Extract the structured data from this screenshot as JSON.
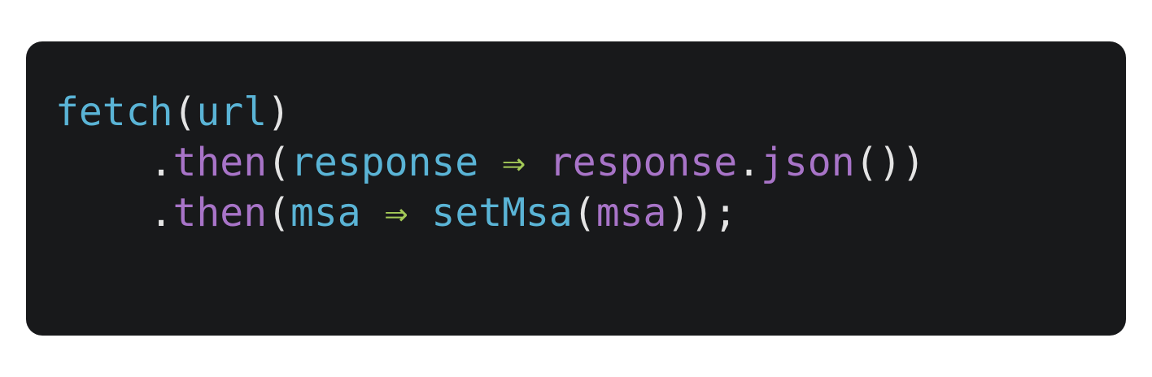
{
  "colors": {
    "background": "#ffffff",
    "panel": "#18191b",
    "function": "#5ab4d6",
    "method": "#a874c8",
    "arrow": "#a3c957",
    "punctuation": "#e4e4e4"
  },
  "code": {
    "lines": [
      {
        "indent": "",
        "tokens": [
          {
            "text": "fetch",
            "kind": "fn"
          },
          {
            "text": "(",
            "kind": "punct"
          },
          {
            "text": "url",
            "kind": "param"
          },
          {
            "text": ")",
            "kind": "punct"
          }
        ]
      },
      {
        "indent": "    ",
        "tokens": [
          {
            "text": ".",
            "kind": "punct"
          },
          {
            "text": "then",
            "kind": "method"
          },
          {
            "text": "(",
            "kind": "punct"
          },
          {
            "text": "response",
            "kind": "param"
          },
          {
            "text": " ",
            "kind": "plain"
          },
          {
            "text": "⇒",
            "kind": "arrow"
          },
          {
            "text": " ",
            "kind": "plain"
          },
          {
            "text": "response",
            "kind": "var"
          },
          {
            "text": ".",
            "kind": "punct"
          },
          {
            "text": "json",
            "kind": "method"
          },
          {
            "text": "())",
            "kind": "punct"
          }
        ]
      },
      {
        "indent": "    ",
        "tokens": [
          {
            "text": ".",
            "kind": "punct"
          },
          {
            "text": "then",
            "kind": "method"
          },
          {
            "text": "(",
            "kind": "punct"
          },
          {
            "text": "msa",
            "kind": "param"
          },
          {
            "text": " ",
            "kind": "plain"
          },
          {
            "text": "⇒",
            "kind": "arrow"
          },
          {
            "text": " ",
            "kind": "plain"
          },
          {
            "text": "setMsa",
            "kind": "fn"
          },
          {
            "text": "(",
            "kind": "punct"
          },
          {
            "text": "msa",
            "kind": "var"
          },
          {
            "text": "));",
            "kind": "punct"
          }
        ]
      }
    ]
  }
}
